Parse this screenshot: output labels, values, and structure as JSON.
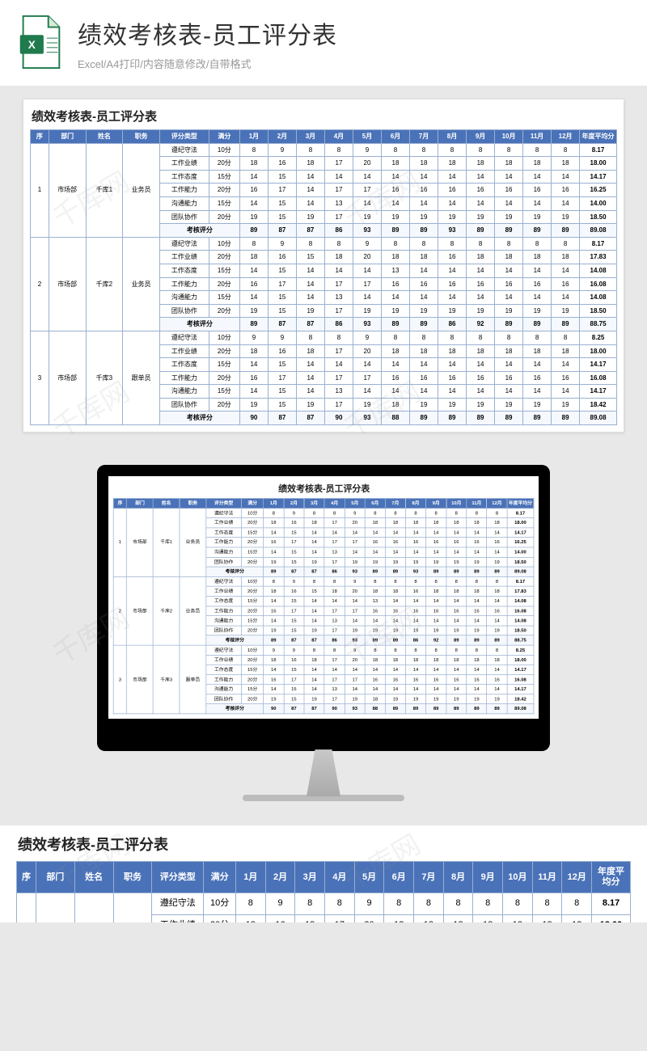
{
  "banner": {
    "title": "绩效考核表-员工评分表",
    "subtitle": "Excel/A4打印/内容随意修改/自带格式"
  },
  "table": {
    "title": "绩效考核表-员工评分表",
    "headers": [
      "序",
      "部门",
      "姓名",
      "职务",
      "评分类型",
      "满分",
      "1月",
      "2月",
      "3月",
      "4月",
      "5月",
      "6月",
      "7月",
      "8月",
      "9月",
      "10月",
      "11月",
      "12月",
      "年度平均分"
    ],
    "groups": [
      {
        "seq": "1",
        "dept": "市场部",
        "name": "千库1",
        "role": "业务员",
        "rows": [
          {
            "type": "遵纪守法",
            "full": "10分",
            "m": [
              "8",
              "9",
              "8",
              "8",
              "9",
              "8",
              "8",
              "8",
              "8",
              "8",
              "8",
              "8"
            ],
            "avg": "8.17"
          },
          {
            "type": "工作业绩",
            "full": "20分",
            "m": [
              "18",
              "16",
              "18",
              "17",
              "20",
              "18",
              "18",
              "18",
              "18",
              "18",
              "18",
              "18"
            ],
            "avg": "18.00"
          },
          {
            "type": "工作态度",
            "full": "15分",
            "m": [
              "14",
              "15",
              "14",
              "14",
              "14",
              "14",
              "14",
              "14",
              "14",
              "14",
              "14",
              "14"
            ],
            "avg": "14.17"
          },
          {
            "type": "工作能力",
            "full": "20分",
            "m": [
              "16",
              "17",
              "14",
              "17",
              "17",
              "16",
              "16",
              "16",
              "16",
              "16",
              "16",
              "16"
            ],
            "avg": "16.25"
          },
          {
            "type": "沟通能力",
            "full": "15分",
            "m": [
              "14",
              "15",
              "14",
              "13",
              "14",
              "14",
              "14",
              "14",
              "14",
              "14",
              "14",
              "14"
            ],
            "avg": "14.00"
          },
          {
            "type": "团队协作",
            "full": "20分",
            "m": [
              "19",
              "15",
              "19",
              "17",
              "19",
              "19",
              "19",
              "19",
              "19",
              "19",
              "19",
              "19"
            ],
            "avg": "18.50"
          }
        ],
        "sum": {
          "type": "考核评分",
          "m": [
            "89",
            "87",
            "87",
            "86",
            "93",
            "89",
            "89",
            "93",
            "89",
            "89",
            "89",
            "89"
          ],
          "avg": "89.08"
        }
      },
      {
        "seq": "2",
        "dept": "市场部",
        "name": "千库2",
        "role": "业务员",
        "rows": [
          {
            "type": "遵纪守法",
            "full": "10分",
            "m": [
              "8",
              "9",
              "8",
              "8",
              "9",
              "8",
              "8",
              "8",
              "8",
              "8",
              "8",
              "8"
            ],
            "avg": "8.17"
          },
          {
            "type": "工作业绩",
            "full": "20分",
            "m": [
              "18",
              "16",
              "15",
              "18",
              "20",
              "18",
              "18",
              "16",
              "18",
              "18",
              "18",
              "18"
            ],
            "avg": "17.83"
          },
          {
            "type": "工作态度",
            "full": "15分",
            "m": [
              "14",
              "15",
              "14",
              "14",
              "14",
              "13",
              "14",
              "14",
              "14",
              "14",
              "14",
              "14"
            ],
            "avg": "14.08"
          },
          {
            "type": "工作能力",
            "full": "20分",
            "m": [
              "16",
              "17",
              "14",
              "17",
              "17",
              "16",
              "16",
              "16",
              "16",
              "16",
              "16",
              "16"
            ],
            "avg": "16.08"
          },
          {
            "type": "沟通能力",
            "full": "15分",
            "m": [
              "14",
              "15",
              "14",
              "13",
              "14",
              "14",
              "14",
              "14",
              "14",
              "14",
              "14",
              "14"
            ],
            "avg": "14.08"
          },
          {
            "type": "团队协作",
            "full": "20分",
            "m": [
              "19",
              "15",
              "19",
              "17",
              "19",
              "19",
              "19",
              "19",
              "19",
              "19",
              "19",
              "19"
            ],
            "avg": "18.50"
          }
        ],
        "sum": {
          "type": "考核评分",
          "m": [
            "89",
            "87",
            "87",
            "86",
            "93",
            "89",
            "89",
            "86",
            "92",
            "89",
            "89",
            "89"
          ],
          "avg": "88.75"
        }
      },
      {
        "seq": "3",
        "dept": "市场部",
        "name": "千库3",
        "role": "跟单员",
        "rows": [
          {
            "type": "遵纪守法",
            "full": "10分",
            "m": [
              "9",
              "9",
              "8",
              "8",
              "9",
              "8",
              "8",
              "8",
              "8",
              "8",
              "8",
              "8"
            ],
            "avg": "8.25"
          },
          {
            "type": "工作业绩",
            "full": "20分",
            "m": [
              "18",
              "16",
              "18",
              "17",
              "20",
              "18",
              "18",
              "18",
              "18",
              "18",
              "18",
              "18"
            ],
            "avg": "18.00"
          },
          {
            "type": "工作态度",
            "full": "15分",
            "m": [
              "14",
              "15",
              "14",
              "14",
              "14",
              "14",
              "14",
              "14",
              "14",
              "14",
              "14",
              "14"
            ],
            "avg": "14.17"
          },
          {
            "type": "工作能力",
            "full": "20分",
            "m": [
              "16",
              "17",
              "14",
              "17",
              "17",
              "16",
              "16",
              "16",
              "16",
              "16",
              "16",
              "16"
            ],
            "avg": "16.08"
          },
          {
            "type": "沟通能力",
            "full": "15分",
            "m": [
              "14",
              "15",
              "14",
              "13",
              "14",
              "14",
              "14",
              "14",
              "14",
              "14",
              "14",
              "14"
            ],
            "avg": "14.17"
          },
          {
            "type": "团队协作",
            "full": "20分",
            "m": [
              "19",
              "15",
              "19",
              "17",
              "19",
              "18",
              "19",
              "19",
              "19",
              "19",
              "19",
              "19"
            ],
            "avg": "18.42"
          }
        ],
        "sum": {
          "type": "考核评分",
          "m": [
            "90",
            "87",
            "87",
            "90",
            "93",
            "88",
            "89",
            "89",
            "89",
            "89",
            "89",
            "89"
          ],
          "avg": "89.08"
        }
      }
    ]
  },
  "watermark": "千库网"
}
